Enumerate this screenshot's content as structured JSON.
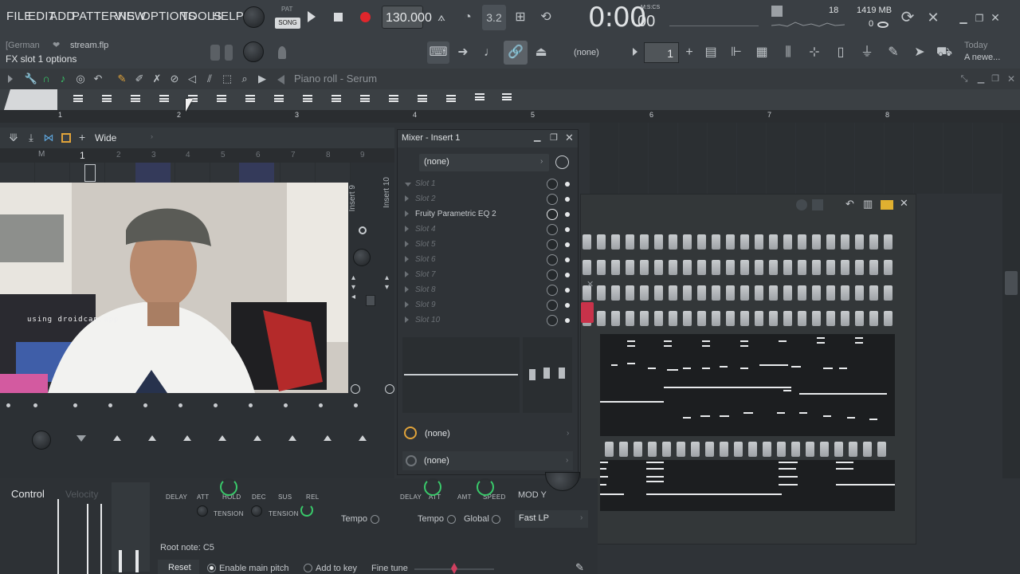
{
  "menu": {
    "file": "FILE",
    "edit": "EDIT",
    "add": "ADD",
    "patterns": "PATTERNS",
    "view": "VIEW",
    "options": "OPTIONS",
    "tools": "TOOLS",
    "help": "HELP"
  },
  "transport": {
    "pat_label": "PAT",
    "song_label": "SONG",
    "tempo": "130.000",
    "time": "0:00",
    "time_small": "00",
    "time_unit": "M:S:CS",
    "step_value": "3.2",
    "cpu_count": "18",
    "memory": "1419 MB",
    "voice_count": "0"
  },
  "hint": {
    "language": "[German",
    "project_file": "stream.flp",
    "status": "FX slot 1 options"
  },
  "toolbar2": {
    "pattern_none": "(none)",
    "pattern_number": "1",
    "news_title": "Today",
    "news_text": "A newe..."
  },
  "piano_roll": {
    "title": "Piano roll - Serum",
    "ruler": [
      "1",
      "2",
      "3",
      "4",
      "5",
      "6",
      "7",
      "8"
    ]
  },
  "channel_rack": {
    "preset": "Wide",
    "bar_marks": [
      "M",
      "1",
      "2",
      "3",
      "4",
      "5",
      "6",
      "7",
      "8",
      "9"
    ],
    "insert_labels": [
      "Insert 9",
      "Insert 10"
    ],
    "webcam_caption": "using droidcam.app"
  },
  "mixer": {
    "title": "Mixer - Insert 1",
    "input": "(none)",
    "slots": [
      {
        "label": "Slot 1",
        "active": false
      },
      {
        "label": "Slot 2",
        "active": false
      },
      {
        "label": "Fruity Parametric EQ 2",
        "active": true
      },
      {
        "label": "Slot 4",
        "active": false
      },
      {
        "label": "Slot 5",
        "active": false
      },
      {
        "label": "Slot 6",
        "active": false
      },
      {
        "label": "Slot 7",
        "active": false
      },
      {
        "label": "Slot 8",
        "active": false
      },
      {
        "label": "Slot 9",
        "active": false
      },
      {
        "label": "Slot 10",
        "active": false
      }
    ],
    "output_a": "(none)",
    "output_b": "(none)"
  },
  "envelope": {
    "control": "Control",
    "velocity": "Velocity",
    "labels_left": [
      "DELAY",
      "ATT",
      "HOLD",
      "DEC",
      "SUS",
      "REL"
    ],
    "tension": "TENSION",
    "tempo_left": "Tempo",
    "labels_mid": [
      "DELAY",
      "ATT",
      "AMT",
      "SPEED"
    ],
    "tempo_mid": "Tempo",
    "global": "Global",
    "mod_y": "MOD Y",
    "filter": "Fast LP",
    "root_note": "Root note: C5",
    "reset": "Reset",
    "enable_main_pitch": "Enable main pitch",
    "add_to_key": "Add to key",
    "fine_tune": "Fine tune"
  },
  "colors": {
    "accent_green": "#39c96a",
    "record_red": "#e0262c",
    "panel_bg": "#2f3337"
  }
}
